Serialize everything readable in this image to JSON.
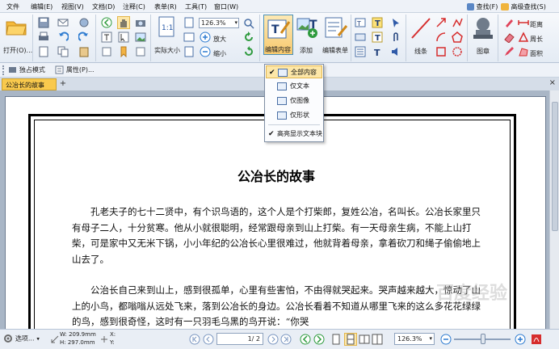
{
  "menu": {
    "items": [
      "文件",
      "编辑(E)",
      "视图(V)",
      "文档(D)",
      "注释(C)",
      "表单(R)",
      "工具(T)",
      "窗口(W)"
    ],
    "find_label": "查找(F)",
    "adv_find_label": "高级查找(S)"
  },
  "ribbon": {
    "open_label": "打开(O)...",
    "zoom_value": "126.3%",
    "actual_size_label": "实际大小",
    "zoom_in_label": "放大",
    "zoom_out_label": "缩小",
    "edit_content_label": "编辑内容",
    "add_label": "添加",
    "edit_form_label": "编辑表单",
    "line_label": "线条",
    "stamp_label": "图章",
    "distance_label": "距离",
    "perimeter_label": "周长",
    "area_label": "面积"
  },
  "secondary": {
    "exclusive_mode_label": "独占模式",
    "properties_label": "属性(P)..."
  },
  "tab": {
    "title": "公冶长的故事",
    "add": "+",
    "close": "×"
  },
  "popup": {
    "items": [
      {
        "label": "全部内容",
        "checked": true
      },
      {
        "label": "仅文本",
        "checked": false
      },
      {
        "label": "仅图像",
        "checked": false
      },
      {
        "label": "仅形状",
        "checked": false
      },
      {
        "label": "高亮显示文本块",
        "checked": true
      }
    ]
  },
  "document": {
    "title": "公冶长的故事",
    "paragraphs": [
      "孔老夫子的七十二贤中，有个识鸟语的，这个人是个打柴郎，复姓公冶，名叫长。公冶长家里只有母子二人，十分贫寒。他从小就很聪明，经常跟母亲到山上打柴。有一天母亲生病，不能上山打柴，可是家中又无米下锅，小小年纪的公冶长心里很难过，他就背着母亲，拿着砍刀和绳子偷偷地上山去了。",
      "公治长自己来到山上，感到很孤单，心里有些害怕，不由得就哭起来。哭声越来越大，惊动了山上的小鸟，都嗡嗡从远处飞来，落到公冶长的身边。公冶长看着不知道从哪里飞来的这么多花花绿绿的鸟，感到很奇怪，这时有一只羽毛乌黑的鸟开说：“你哭"
    ]
  },
  "status": {
    "select_label": "选项...",
    "width_label": "W: 209.9mm",
    "height_label": "H: 297.0mm",
    "x_label": "X:",
    "y_label": "Y:",
    "page_value": "1",
    "page_total": "/ 2",
    "zoom_value": "126.3%"
  },
  "watermark": "百度经验",
  "colors": {
    "accent": "#f9c94d",
    "ribbon_bg": "#e4ebf4",
    "selection": "#fde7a8"
  }
}
